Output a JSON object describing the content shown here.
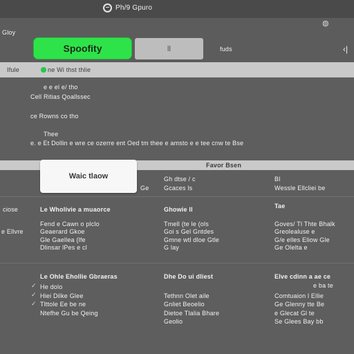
{
  "window": {
    "title": "Ph/9 Gpuro",
    "logo_icon": "spotify-logo-icon"
  },
  "toolbar": {
    "menu_label": "Gloy",
    "primary_button": "Spoofity",
    "secondary_button": "‖",
    "link_label": "fuds",
    "more_icon": "more-dots-icon",
    "expand_icon": "expand-icon"
  },
  "address_bar": {
    "nav_label": "Ifule",
    "address": "ne Wi thst thlie"
  },
  "notes": [
    "e e el e/ tho",
    "Cell Ritias Qoallssec",
    "ce Rowns co tho",
    "Thee",
    "e.  e Et Dollin e wre ce ozerre ent Oed tm thee e amsto e e tee cnw te Bse"
  ],
  "table_band_label": "Favor Bsen",
  "white_button": "Waic tlaow",
  "sections": [
    {
      "left_label": "",
      "col1_head": "",
      "col2_head": "Gh dtse / c",
      "col2_sub": "Gcaces ls",
      "col3_head": "Bl",
      "col3_sub": "Wessle Ellcliei be",
      "left_extra": "Ge"
    },
    {
      "left_label": "ciose",
      "left_label2": "e Ellvre",
      "col1_head": "Le Wholivie a muaorce",
      "col2_head": "Ghowie ll",
      "col3_head": "Tae",
      "col1_rows": [
        "Fend e Cawn o plclo",
        "Geaerard Gkoe",
        "Gle Gaellea (lfe",
        "Dlinsar lPes e cl"
      ],
      "col2_rows": [
        "Tmell (te le (ols",
        "Goi s Gel Gntdes",
        "Gmne wtl dloe Gtle",
        "G lay"
      ],
      "col3_rows": [
        "Goves/ Tl Thte Bhalk",
        "Greolealuse e",
        "G/e elles Eliow Gle",
        "Ge Olelta e"
      ]
    },
    {
      "col1_head": "Le Ohle Ehollie Gbraeras",
      "col2_head": "Dhe Do ui dliest",
      "col3_head": "Elve cdinn a ae ce",
      "col3_sub": "e ba te",
      "col1_rows": [
        "He dolo",
        "Hiei Dilke Glee",
        "Tlttole Ee be ne",
        "Ntefhe Gu be Qeing"
      ],
      "col2_rows": [
        "Tethnn Olet aile",
        "Gnliet Beoelio",
        "Dietoe Tlalia Bhare",
        "Geolio"
      ],
      "col3_rows": [
        "Comtuaion l Ellie",
        "Ge Glenny tte Be",
        "e Glecat Gl te",
        "Se Glees Bay bb"
      ]
    }
  ]
}
